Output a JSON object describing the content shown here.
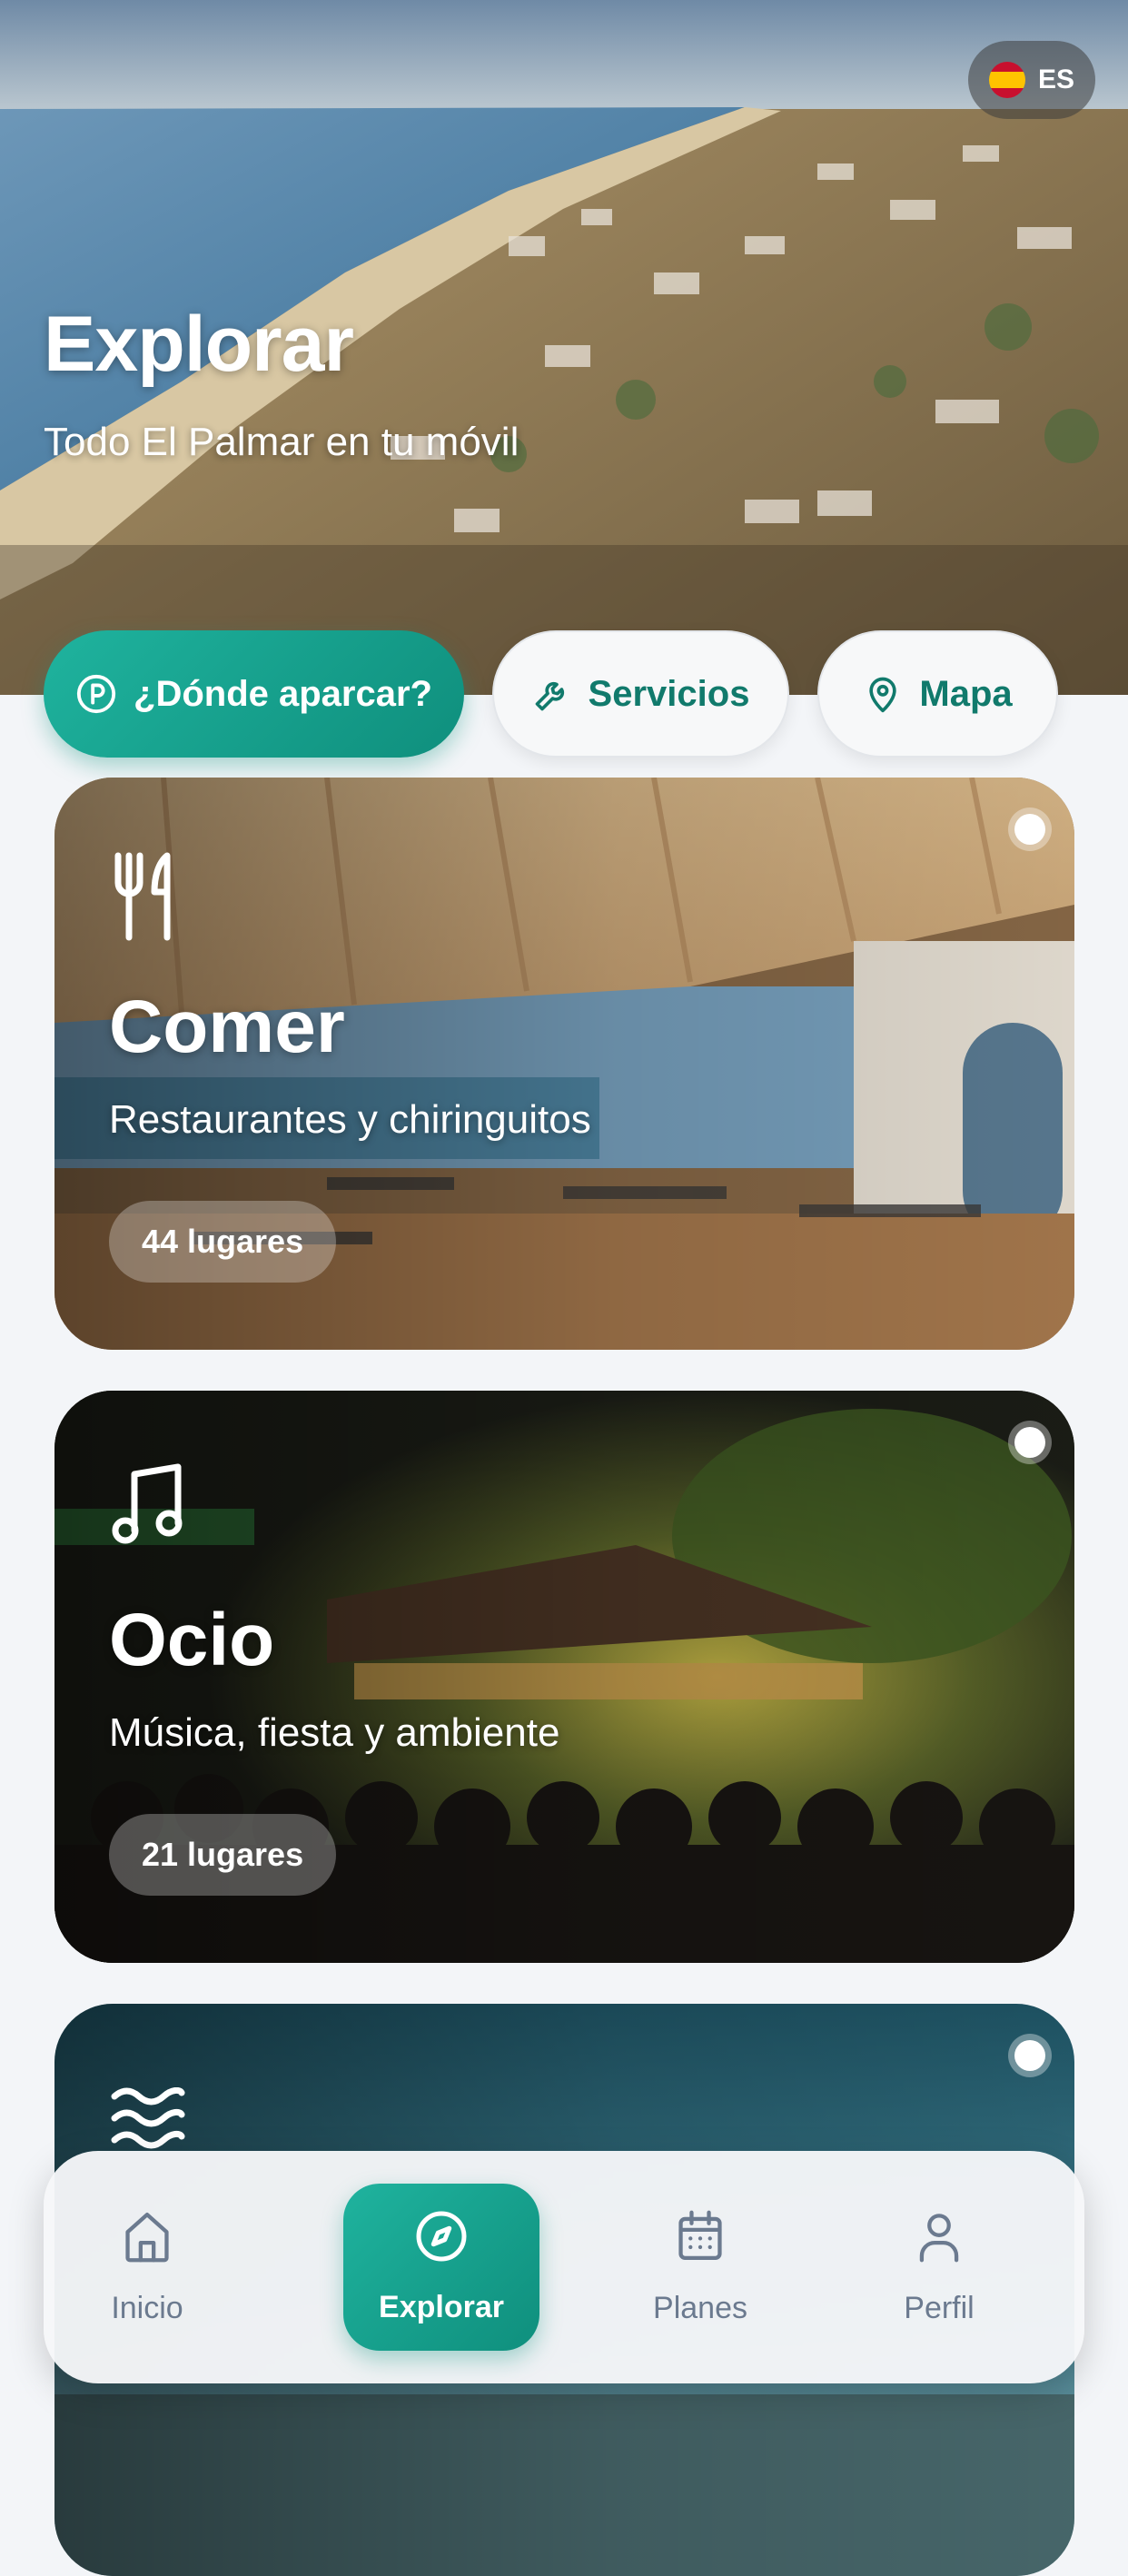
{
  "header": {
    "title": "Explorar",
    "subtitle": "Todo El Palmar en tu móvil",
    "language": "ES"
  },
  "quick_actions": [
    {
      "label": "¿Dónde aparcar?",
      "icon": "parking-icon"
    },
    {
      "label": "Servicios",
      "icon": "wrench-icon"
    },
    {
      "label": "Mapa",
      "icon": "map-pin-icon"
    }
  ],
  "categories": [
    {
      "title": "Comer",
      "subtitle": "Restaurantes y chiringuitos",
      "count": "44 lugares",
      "icon": "utensils-icon"
    },
    {
      "title": "Ocio",
      "subtitle": "Música, fiesta y ambiente",
      "count": "21 lugares",
      "icon": "music-icon"
    },
    {
      "title": "",
      "subtitle": "",
      "count": "",
      "icon": "waves-icon"
    }
  ],
  "bottom_nav": [
    {
      "label": "Inicio",
      "icon": "home-icon",
      "active": false
    },
    {
      "label": "Explorar",
      "icon": "compass-icon",
      "active": true
    },
    {
      "label": "Planes",
      "icon": "calendar-icon",
      "active": false
    },
    {
      "label": "Perfil",
      "icon": "user-icon",
      "active": false
    }
  ],
  "colors": {
    "accent": "#14a08c",
    "accent_text": "#117a6c",
    "nav_inactive": "#6b7a8f",
    "background": "#f3f5f8"
  }
}
